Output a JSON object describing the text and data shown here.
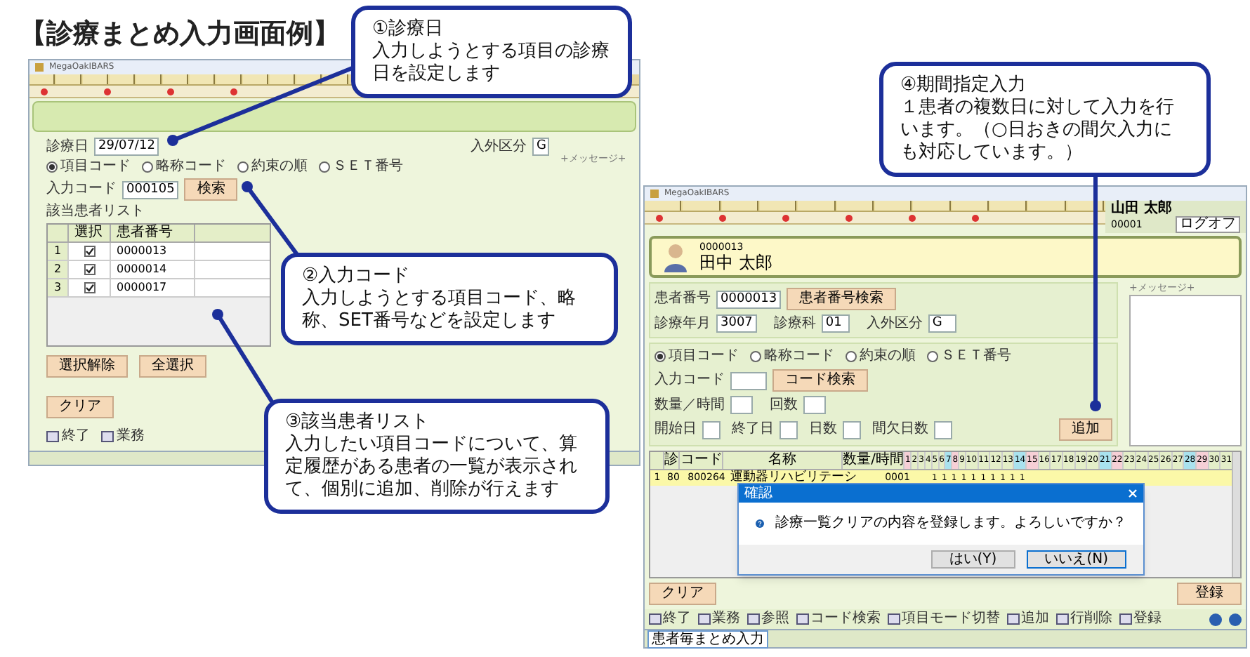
{
  "title": "【診療まとめ入力画面例】",
  "left_screen": {
    "window_title": "MegaOakIBARS",
    "message_label": "+メッセージ+",
    "date": {
      "label": "診療日",
      "value": "29/07/12"
    },
    "ward": {
      "label": "入外区分",
      "value": "G"
    },
    "radios": [
      {
        "label": "項目コード",
        "selected": true
      },
      {
        "label": "略称コード",
        "selected": false
      },
      {
        "label": "約束の順",
        "selected": false
      },
      {
        "label": "ＳＥＴ番号",
        "selected": false
      }
    ],
    "code": {
      "label": "入力コード",
      "value": "000105",
      "button": "検索"
    },
    "list_title": "該当患者リスト",
    "columns": [
      "選択",
      "患者番号"
    ],
    "rows": [
      {
        "index": "1",
        "number": "0000013",
        "checked": true
      },
      {
        "index": "2",
        "number": "0000014",
        "checked": true
      },
      {
        "index": "3",
        "number": "0000017",
        "checked": true
      }
    ],
    "buttons": [
      "選択解除",
      "全選択"
    ],
    "clear_button": "クリア",
    "function_keys": [
      "終了",
      "業務"
    ]
  },
  "right_screen": {
    "window_title": "MegaOakIBARS",
    "user": {
      "name": "山田 太郎",
      "id": "00001",
      "logoff": "ログオフ"
    },
    "patient": {
      "number": "0000013",
      "name": "田中 太郎"
    },
    "patient_number": {
      "label": "患者番号",
      "value": "0000013",
      "button": "患者番号検索"
    },
    "visit_fields": [
      {
        "label": "診療年月",
        "value": "3007"
      },
      {
        "label": "診療科",
        "value": "01"
      },
      {
        "label": "入外区分",
        "value": "G"
      }
    ],
    "message_label": "+メッセージ+",
    "radios": [
      {
        "label": "項目コード",
        "selected": true
      },
      {
        "label": "略称コード",
        "selected": false
      },
      {
        "label": "約束の順",
        "selected": false
      },
      {
        "label": "ＳＥＴ番号",
        "selected": false
      }
    ],
    "code": {
      "label": "入力コード",
      "button": "コード検索"
    },
    "quantity_fields": [
      "数量／時間",
      "回数"
    ],
    "period_fields": [
      "開始日",
      "終了日",
      "日数",
      "間欠日数"
    ],
    "add_button": "追加",
    "grid": {
      "columns": [
        "診",
        "コード",
        "名称",
        "数量/時間"
      ],
      "days": [
        {
          "label": "1",
          "kind": "sunday"
        },
        {
          "label": "2",
          "kind": "weekday"
        },
        {
          "label": "3",
          "kind": "weekday"
        },
        {
          "label": "4",
          "kind": "weekday"
        },
        {
          "label": "5",
          "kind": "weekday"
        },
        {
          "label": "6",
          "kind": "weekday"
        },
        {
          "label": "7",
          "kind": "saturday"
        },
        {
          "label": "8",
          "kind": "sunday"
        },
        {
          "label": "9",
          "kind": "weekday"
        },
        {
          "label": "10",
          "kind": "weekday"
        },
        {
          "label": "11",
          "kind": "weekday"
        },
        {
          "label": "12",
          "kind": "weekday"
        },
        {
          "label": "13",
          "kind": "weekday"
        },
        {
          "label": "14",
          "kind": "saturday"
        },
        {
          "label": "15",
          "kind": "sunday"
        },
        {
          "label": "16",
          "kind": "weekday"
        },
        {
          "label": "17",
          "kind": "weekday"
        },
        {
          "label": "18",
          "kind": "weekday"
        },
        {
          "label": "19",
          "kind": "weekday"
        },
        {
          "label": "20",
          "kind": "weekday"
        },
        {
          "label": "21",
          "kind": "saturday"
        },
        {
          "label": "22",
          "kind": "sunday"
        },
        {
          "label": "23",
          "kind": "weekday"
        },
        {
          "label": "24",
          "kind": "weekday"
        },
        {
          "label": "25",
          "kind": "weekday"
        },
        {
          "label": "26",
          "kind": "weekday"
        },
        {
          "label": "27",
          "kind": "weekday"
        },
        {
          "label": "28",
          "kind": "saturday"
        },
        {
          "label": "29",
          "kind": "sunday"
        },
        {
          "label": "30",
          "kind": "weekday"
        },
        {
          "label": "31",
          "kind": "weekday"
        }
      ],
      "rows": [
        {
          "index": "1",
          "dept": "80",
          "code": "800264",
          "name": "運動器リハビリテーシ",
          "quantity": "0001",
          "counts": [
            "1",
            "1",
            "1",
            "1",
            "1",
            "1",
            "1",
            "1",
            "1",
            "1"
          ]
        }
      ]
    },
    "dialog": {
      "title": "確認",
      "message": "診療一覧クリアの内容を登録します。よろしいですか？",
      "buttons": [
        "はい(Y)",
        "いいえ(N)"
      ]
    },
    "clear_button": "クリア",
    "register_button": "登録",
    "function_keys": [
      "終了",
      "業務",
      "参照",
      "コード検索",
      "項目モード切替",
      "追加",
      "行削除",
      "登録"
    ],
    "status": "患者毎まとめ入力"
  },
  "callouts": [
    {
      "heading": "①診療日",
      "body": "入力しようとする項目の診療日を設定します"
    },
    {
      "heading": "②入力コード",
      "body": "入力しようとする項目コード、略称、SET番号などを設定します"
    },
    {
      "heading": "③該当患者リスト",
      "body": "入力したい項目コードについて、算定履歴がある患者の一覧が表示されて、個別に追加、削除が行えます"
    },
    {
      "heading": "④期間指定入力",
      "body": "１患者の複数日に対して入力を行います。（○日おきの間欠入力にも対応しています。）"
    }
  ]
}
